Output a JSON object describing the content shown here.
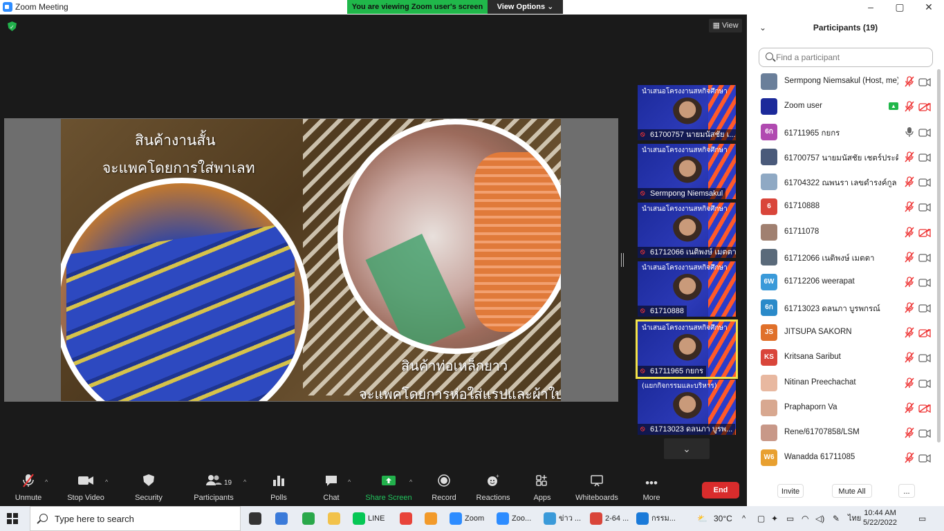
{
  "window": {
    "title": "Zoom Meeting",
    "viewing_banner": "You are viewing Zoom user's screen",
    "view_options_label": "View Options ⌄",
    "minimize": "–",
    "maximize": "▢",
    "close": "✕"
  },
  "meeting": {
    "view_label": "View",
    "slide": {
      "heading1_line1": "สินค้างานสั้น",
      "heading1_line2": "จะแพคโดยการใส่พาเลท",
      "heading2_line1": "สินค้าท่อเหล็กยาว",
      "heading2_line2": "จะแพคโดยการห่อใส่แรปและผ้าใบ"
    },
    "thumbnails": [
      {
        "title": "นำเสนอโครงงานสหกิจศึกษา",
        "name": "61700757 นายมนัสชัย เ...",
        "active": false
      },
      {
        "title": "นำเสนอโครงงานสหกิจศึกษา",
        "name": "Sermpong Niemsakul",
        "active": false
      },
      {
        "title": "นำเสนอโครงงานสหกิจศึกษา",
        "name": "61712066 เนติพงษ์ เมตตา",
        "active": false
      },
      {
        "title": "นำเสนอโครงงานสหกิจศึกษา",
        "name": "61710888",
        "active": false
      },
      {
        "title": "นำเสนอโครงงานสหกิจศึกษา",
        "name": "61711965 กยกร",
        "active": true
      },
      {
        "title": "(แยกกิจกรรมและบริหาร)",
        "name": "61713023 ดลนภา บูรพ...",
        "active": false
      }
    ],
    "thumb_scroll_icon": "⌄"
  },
  "toolbar": {
    "unmute": "Unmute",
    "stop_video": "Stop Video",
    "security": "Security",
    "participants": "Participants",
    "participants_count": "19",
    "polls": "Polls",
    "chat": "Chat",
    "share_screen": "Share Screen",
    "record": "Record",
    "reactions": "Reactions",
    "apps": "Apps",
    "whiteboards": "Whiteboards",
    "more": "More",
    "end": "End"
  },
  "participants_panel": {
    "title": "Participants (19)",
    "search_placeholder": "Find a participant",
    "participants": [
      {
        "name": "Sermpong Niemsakul (Host, me)",
        "avatar_text": "",
        "avatar_color": "#6a7f9a",
        "mic": "muted",
        "video": "on",
        "sharing": false
      },
      {
        "name": "Zoom user",
        "avatar_text": "",
        "avatar_color": "#1c2a9a",
        "mic": "muted",
        "video": "off",
        "sharing": true
      },
      {
        "name": "61711965 กยกร",
        "avatar_text": "6ก",
        "avatar_color": "#b04ab0",
        "mic": "on",
        "video": "on",
        "sharing": false
      },
      {
        "name": "61700757 นายมนัสชัย เชตร์ประดิษฐ์",
        "avatar_text": "",
        "avatar_color": "#4a5a7a",
        "mic": "muted",
        "video": "on",
        "sharing": false
      },
      {
        "name": "61704322 ณพนรา เลขดำรงค์กูล",
        "avatar_text": "",
        "avatar_color": "#8fa9c4",
        "mic": "muted",
        "video": "on",
        "sharing": false
      },
      {
        "name": "61710888",
        "avatar_text": "6",
        "avatar_color": "#d9453a",
        "mic": "muted",
        "video": "on",
        "sharing": false
      },
      {
        "name": "61711078",
        "avatar_text": "",
        "avatar_color": "#a08070",
        "mic": "muted",
        "video": "off",
        "sharing": false
      },
      {
        "name": "61712066 เนติพงษ์ เมตตา",
        "avatar_text": "",
        "avatar_color": "#5a6a7a",
        "mic": "muted",
        "video": "on",
        "sharing": false
      },
      {
        "name": "61712206 weerapat",
        "avatar_text": "6W",
        "avatar_color": "#3a9ad9",
        "mic": "muted",
        "video": "on",
        "sharing": false
      },
      {
        "name": "61713023 ดลนภา บูรพกรณ์",
        "avatar_text": "6ก",
        "avatar_color": "#2a8ac9",
        "mic": "muted",
        "video": "on",
        "sharing": false
      },
      {
        "name": "JITSUPA  SAKORN",
        "avatar_text": "JS",
        "avatar_color": "#e0702a",
        "mic": "muted",
        "video": "off",
        "sharing": false
      },
      {
        "name": "Kritsana Saribut",
        "avatar_text": "KS",
        "avatar_color": "#d9453a",
        "mic": "muted",
        "video": "on",
        "sharing": false
      },
      {
        "name": "Nitinan Preechachat",
        "avatar_text": "",
        "avatar_color": "#e8b8a0",
        "mic": "muted",
        "video": "on",
        "sharing": false
      },
      {
        "name": "Praphaporn Va",
        "avatar_text": "",
        "avatar_color": "#d8a890",
        "mic": "muted",
        "video": "off",
        "sharing": false
      },
      {
        "name": "Rene/61707858/LSM",
        "avatar_text": "",
        "avatar_color": "#c89888",
        "mic": "muted",
        "video": "on",
        "sharing": false
      },
      {
        "name": "Wanadda 61711085",
        "avatar_text": "W6",
        "avatar_color": "#e8a030",
        "mic": "muted",
        "video": "on",
        "sharing": false
      }
    ],
    "invite": "Invite",
    "mute_all": "Mute All",
    "more": "..."
  },
  "taskbar": {
    "search_placeholder": "Type here to search",
    "apps": [
      {
        "label": "",
        "icon": "task-view-icon",
        "color": "#333333"
      },
      {
        "label": "",
        "icon": "app-icon",
        "color": "#3a7ad9"
      },
      {
        "label": "",
        "icon": "app-icon",
        "color": "#2aa84a"
      },
      {
        "label": "",
        "icon": "folder-icon",
        "color": "#f2c24a"
      },
      {
        "label": "LINE",
        "icon": "line-icon",
        "color": "#06c755"
      },
      {
        "label": "",
        "icon": "chrome-icon",
        "color": "#e8443a"
      },
      {
        "label": "",
        "icon": "app-icon",
        "color": "#f29a2a"
      },
      {
        "label": "Zoom",
        "icon": "zoom-icon",
        "color": "#2d8cff"
      },
      {
        "label": "Zoo...",
        "icon": "zoom-icon",
        "color": "#2d8cff"
      },
      {
        "label": "ข่าว ...",
        "icon": "ie-icon",
        "color": "#3a9ad9"
      },
      {
        "label": "2-64 ...",
        "icon": "pdf-icon",
        "color": "#d9453a"
      },
      {
        "label": "กรรม...",
        "icon": "edge-icon",
        "color": "#1a7ad9"
      }
    ],
    "temperature": "30°C",
    "language": "ไทย",
    "time": "10:44 AM",
    "date": "5/22/2022"
  }
}
